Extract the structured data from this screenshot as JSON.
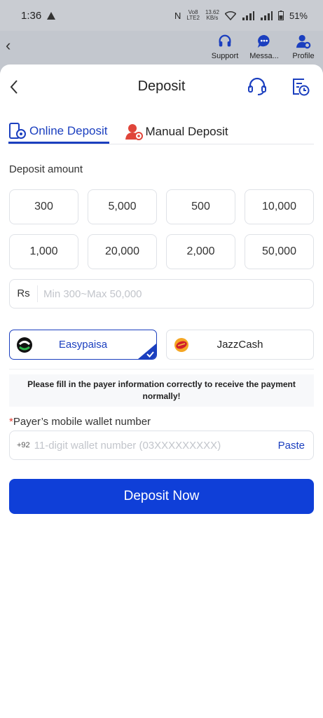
{
  "status_bar": {
    "time": "1:36",
    "nfc": "N",
    "volte_top": "Vo8",
    "volte_bottom": "LTE2",
    "speed_top": "13.62",
    "speed_bottom": "KB/s",
    "battery": "51%"
  },
  "background_nav": {
    "support": "Support",
    "messages": "Messa...",
    "profile": "Profile"
  },
  "header": {
    "title": "Deposit"
  },
  "tabs": [
    {
      "label": "Online Deposit",
      "active": true
    },
    {
      "label": "Manual Deposit",
      "active": false
    }
  ],
  "deposit_amount": {
    "label": "Deposit amount",
    "options": [
      "300",
      "5,000",
      "500",
      "10,000",
      "1,000",
      "20,000",
      "2,000",
      "50,000"
    ]
  },
  "amount_input": {
    "currency": "Rs",
    "placeholder": "Min 300~Max 50,000"
  },
  "payment_methods": [
    {
      "name": "Easypaisa",
      "selected": true
    },
    {
      "name": "JazzCash",
      "selected": false
    }
  ],
  "notice": "Please fill in the payer information correctly to receive the payment normally!",
  "wallet": {
    "required_mark": "*",
    "label": "Payer’s mobile wallet number",
    "prefix": "+92",
    "placeholder": "11-digit wallet number (03XXXXXXXXX)",
    "paste": "Paste"
  },
  "submit": "Deposit Now",
  "colors": {
    "accent": "#1b3fbf",
    "button": "#0f3fd8",
    "required": "#e03b30"
  }
}
